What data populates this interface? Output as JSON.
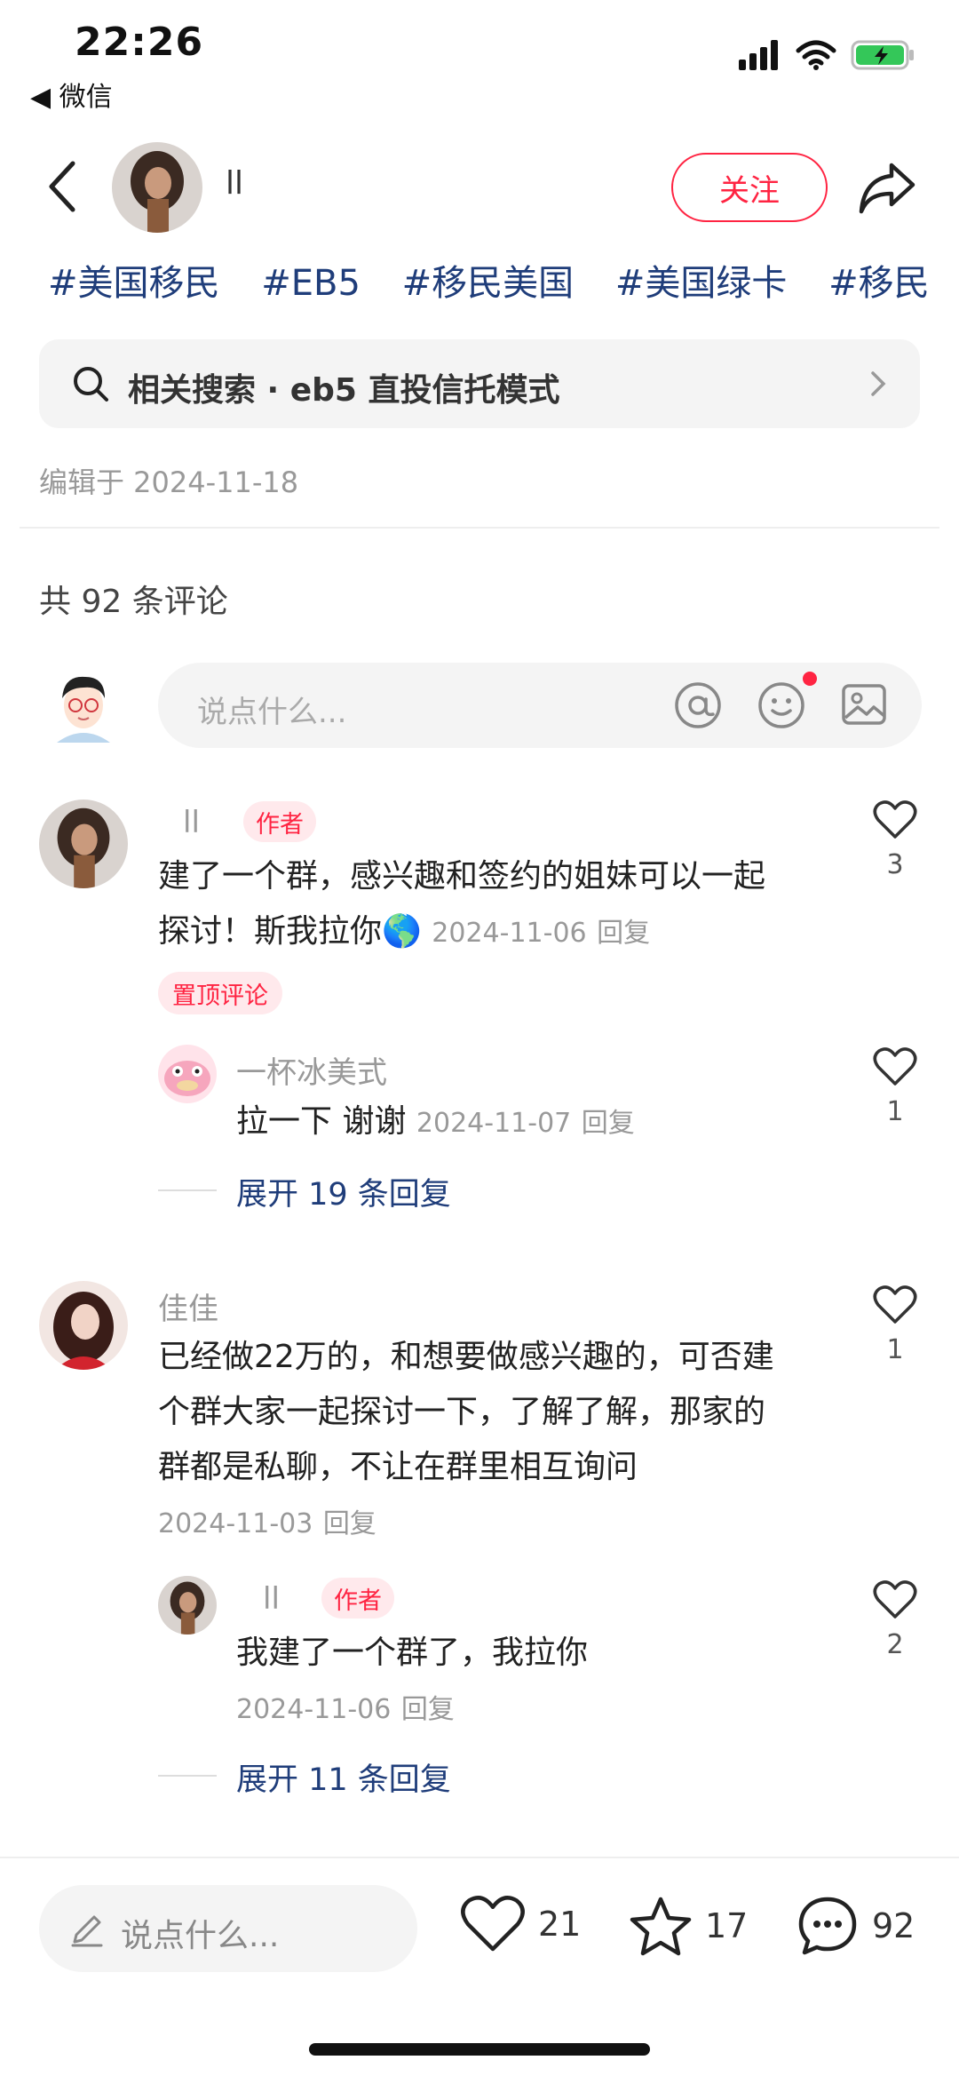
{
  "status_bar": {
    "time": "22:26",
    "back_app": "◀ 微信"
  },
  "header": {
    "author_name": "ll",
    "follow_label": "关注"
  },
  "tags": [
    "#美国移民",
    "#EB5",
    "#移民美国",
    "#美国绿卡",
    "#移民"
  ],
  "related_search": {
    "label": "相关搜索 · eb5 直投信托模式"
  },
  "edit_date": "编辑于 2024-11-18",
  "comment_count": "共 92 条评论",
  "comment_input": {
    "placeholder": "说点什么..."
  },
  "comments": [
    {
      "name": "ll",
      "badge": "作者",
      "text_line1": "建了一个群，感兴趣和签约的姐妹可以一起",
      "text_line2": "探讨！斯我拉你🌎",
      "date": "2024-11-06",
      "reply": "回复",
      "pinned": "置顶评论",
      "likes": "3",
      "replies": [
        {
          "name": "一杯冰美式",
          "text": "拉一下 谢谢",
          "date": "2024-11-07",
          "reply": "回复",
          "likes": "1"
        }
      ],
      "expand": "展开 19 条回复"
    },
    {
      "name": "佳佳",
      "text_line1": "已经做22万的，和想要做感兴趣的，可否建",
      "text_line2": "个群大家一起探讨一下，了解了解，那家的",
      "text_line3": "群都是私聊，不让在群里相互询问",
      "date": "2024-11-03",
      "reply": "回复",
      "likes": "1",
      "replies": [
        {
          "name": "ll",
          "badge": "作者",
          "text": "我建了一个群了，我拉你",
          "date": "2024-11-06",
          "reply": "回复",
          "likes": "2"
        }
      ],
      "expand": "展开 11 条回复"
    }
  ],
  "bottom_bar": {
    "placeholder": "说点什么...",
    "likes": "21",
    "stars": "17",
    "comments": "92"
  },
  "colors": {
    "accent": "#ff2442",
    "link": "#1f3d7a",
    "muted": "#999999"
  }
}
